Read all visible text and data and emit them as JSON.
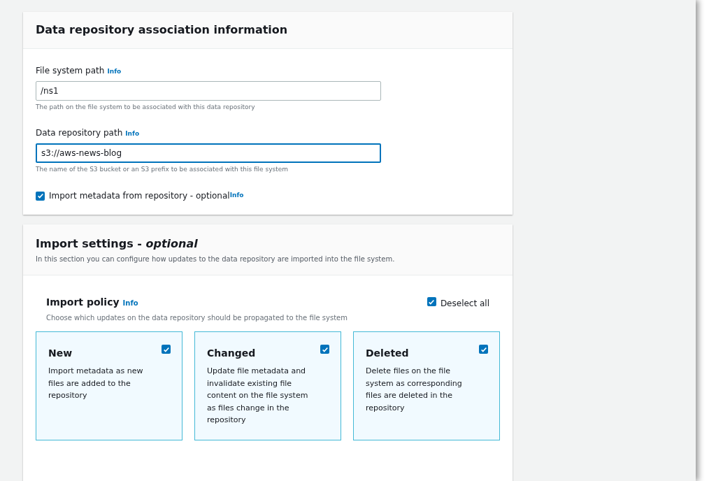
{
  "association": {
    "title": "Data repository association information",
    "fields": [
      {
        "label": "File system path",
        "info": "Info",
        "value": "/ns1",
        "focused": false,
        "hint": "The path on the file system to be associated with this data repository"
      },
      {
        "label": "Data repository path",
        "info": "Info",
        "value": "s3://aws-news-blog",
        "focused": true,
        "hint": "The name of the S3 bucket or an S3 prefix to be associated with this file system"
      }
    ],
    "import_metadata": {
      "label": "Import metadata from repository - optional",
      "info": "Info",
      "checked": true
    }
  },
  "import_settings": {
    "title": "Import settings - *optional*",
    "description": "In this section you can configure how updates to the data repository are imported into the file system.",
    "policy": {
      "title": "Import policy",
      "info": "Info",
      "description": "Choose which updates on the data repository should be propagated to the file system",
      "deselect_all": {
        "label": "Deselect all",
        "checked": true
      },
      "options": [
        {
          "title": "New",
          "description": "Import metadata as new files are added to the repository",
          "checked": true
        },
        {
          "title": "Changed",
          "description": "Update file metadata and invalidate existing file content on the file system as files change in the repository",
          "checked": true
        },
        {
          "title": "Deleted",
          "description": "Delete files on the file system as corresponding files are deleted in the repository",
          "checked": true
        }
      ]
    }
  }
}
